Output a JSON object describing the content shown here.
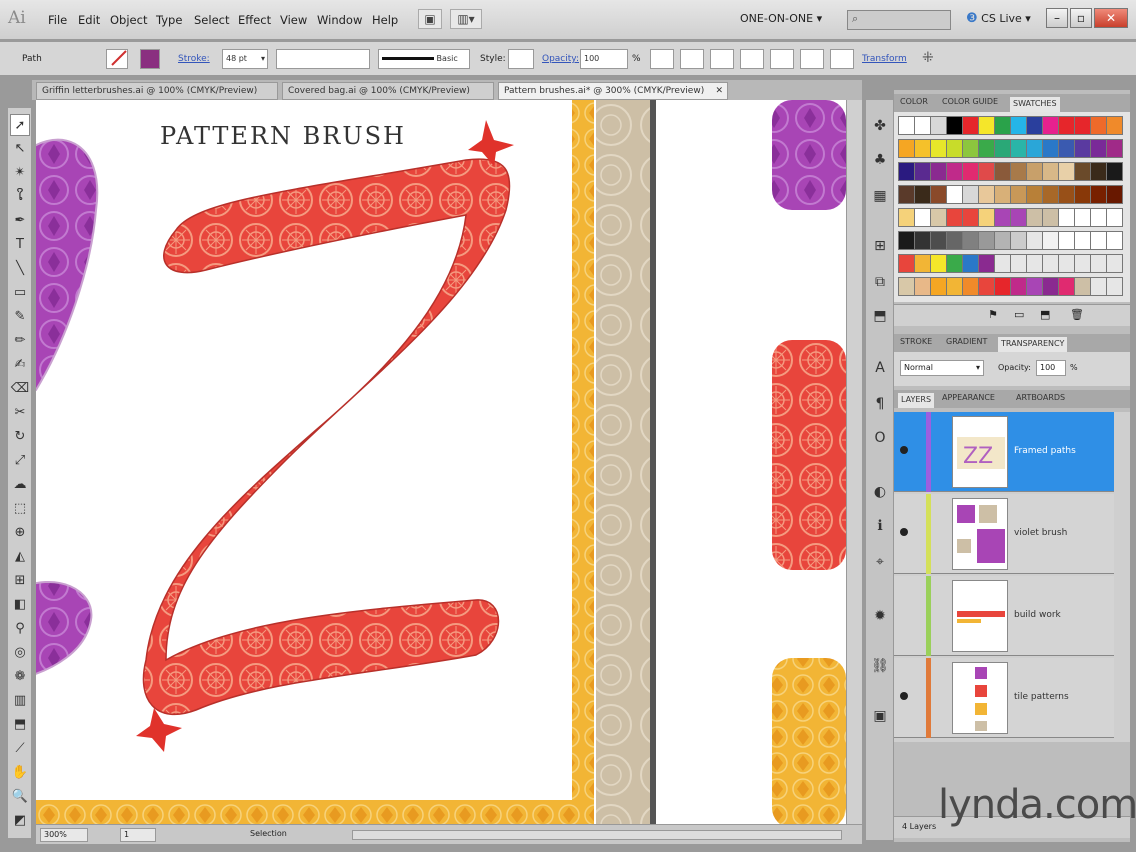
{
  "menubar": {
    "app_logo": "Ai",
    "items": [
      "File",
      "Edit",
      "Object",
      "Type",
      "Select",
      "Effect",
      "View",
      "Window",
      "Help"
    ],
    "workspace": "ONE-ON-ONE ▾",
    "cslive": "CS Live ▾"
  },
  "control": {
    "selection_type": "Path",
    "stroke_label": "Stroke:",
    "stroke_weight": "48 pt",
    "brush_style": "Basic",
    "style_label": "Style:",
    "opacity_label": "Opacity:",
    "opacity_value": "100",
    "opacity_unit": "%",
    "transform_label": "Transform"
  },
  "tabs": [
    "Griffin letterbrushes.ai @ 100% (CMYK/Preview)",
    "Covered bag.ai @ 100% (CMYK/Preview)",
    "Pattern brushes.ai* @ 300% (CMYK/Preview)"
  ],
  "artboard": {
    "title": "PATTERN BRUSH"
  },
  "status": {
    "zoom": "300%",
    "artboard_num": "1",
    "status_text": "Selection"
  },
  "panels": {
    "color_tabs": [
      "COLOR",
      "COLOR GUIDE",
      "SWATCHES"
    ],
    "transparency_tabs": [
      "STROKE",
      "GRADIENT",
      "TRANSPARENCY"
    ],
    "blend_mode": "Normal",
    "opacity_label": "Opacity:",
    "opacity_value": "100",
    "opacity_unit": "%",
    "layer_tabs": [
      "LAYERS",
      "APPEARANCE",
      "ARTBOARDS"
    ],
    "layers": [
      {
        "name": "Framed paths",
        "color": "#9b5fe0",
        "selected": true
      },
      {
        "name": "violet brush",
        "color": "#d4e05a",
        "selected": false
      },
      {
        "name": "build work",
        "color": "#9ad05a",
        "selected": false
      },
      {
        "name": "tile patterns",
        "color": "#e07a3a",
        "selected": false
      }
    ],
    "layer_count": "4 Layers"
  },
  "watermark": "lynda.com",
  "colors": {
    "red_brush": "#e8453c",
    "purple_brush": "#a845b5",
    "yellow_border": "#f2b535",
    "tan_border": "#cdbfa6",
    "selection_blue": "#2f8fe6"
  }
}
